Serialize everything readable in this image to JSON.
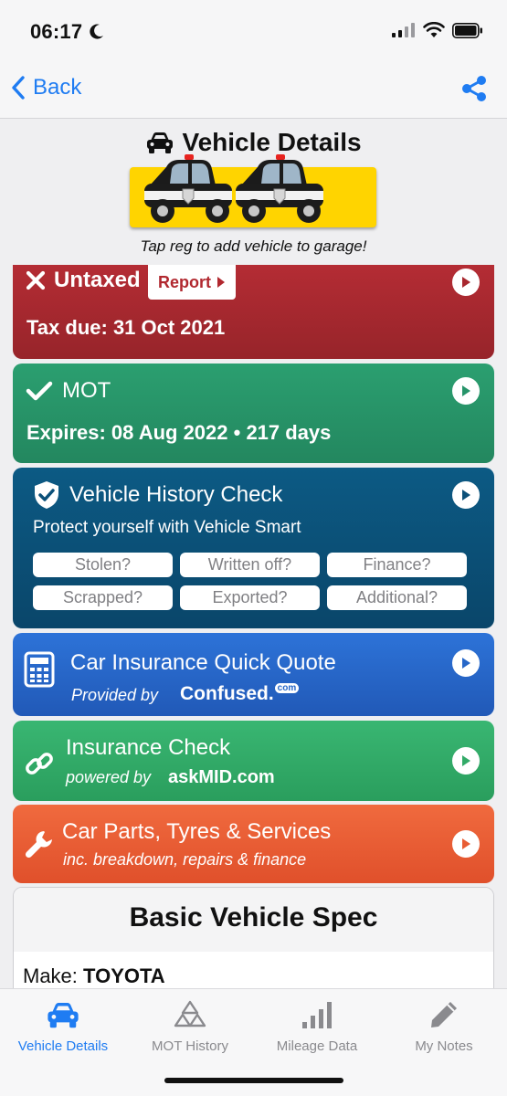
{
  "status": {
    "time": "06:17"
  },
  "nav": {
    "back_label": "Back"
  },
  "header": {
    "title": "Vehicle Details",
    "reg_hint": "Tap reg to add vehicle to garage!"
  },
  "tax": {
    "status": "Untaxed",
    "report_label": "Report",
    "due": "Tax due: 31 Oct 2021"
  },
  "mot": {
    "title": "MOT",
    "expires": "Expires: 08 Aug 2022 • 217 days"
  },
  "history": {
    "title": "Vehicle History Check",
    "subtitle": "Protect yourself with Vehicle Smart",
    "checks": [
      "Stolen?",
      "Written off?",
      "Finance?",
      "Scrapped?",
      "Exported?",
      "Additional?"
    ]
  },
  "insurance_quote": {
    "title": "Car Insurance Quick Quote",
    "provided_by": "Provided by",
    "provider": "Confused.",
    "provider_suffix": "com"
  },
  "insurance_check": {
    "title": "Insurance Check",
    "powered_by": "powered by",
    "provider": "askMID.com"
  },
  "parts": {
    "title": "Car Parts, Tyres & Services",
    "subtitle": "inc. breakdown, repairs & finance"
  },
  "spec": {
    "title": "Basic Vehicle Spec",
    "make_label": "Make:",
    "make_value": "TOYOTA"
  },
  "tabs": [
    {
      "label": "Vehicle Details",
      "icon": "car-icon",
      "active": true
    },
    {
      "label": "MOT History",
      "icon": "mot-triangle-icon",
      "active": false
    },
    {
      "label": "Mileage Data",
      "icon": "bar-chart-icon",
      "active": false
    },
    {
      "label": "My Notes",
      "icon": "pencil-icon",
      "active": false
    }
  ],
  "colors": {
    "accent": "#1f7cf2",
    "tax": "#a8282f",
    "mot": "#27946a",
    "history": "#0b5079",
    "insurance": "#2767c8",
    "check": "#33aa68",
    "parts": "#e85d34"
  }
}
